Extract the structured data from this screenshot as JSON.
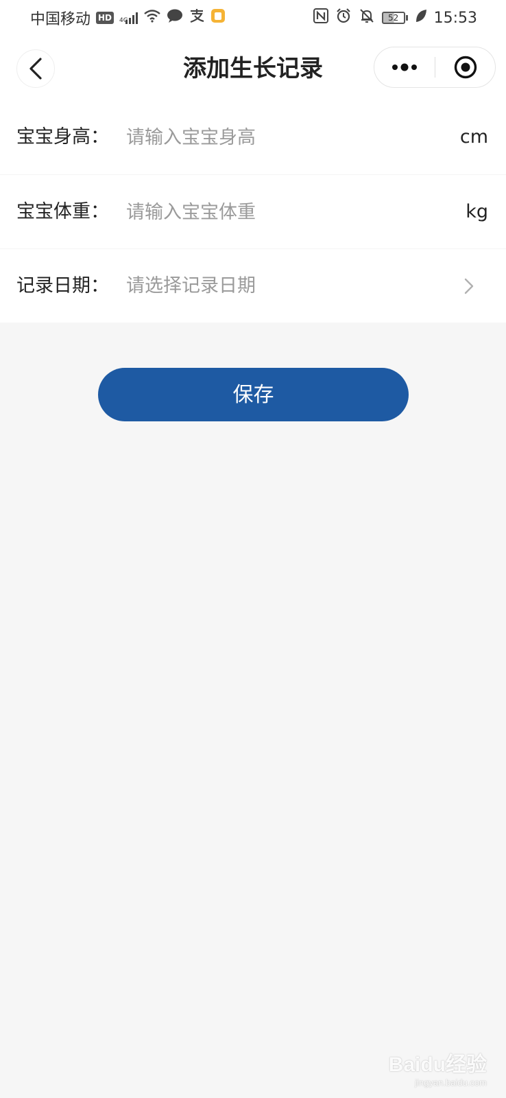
{
  "status_bar": {
    "carrier": "中国移动",
    "hd_badge": "HD",
    "network": "4G",
    "battery_level": "52",
    "time": "15:53",
    "icons_left": [
      "hd-icon",
      "signal-icon",
      "wifi-icon",
      "chat-bubble-icon",
      "alipay-icon",
      "app-notification-icon"
    ],
    "icons_right": [
      "nfc-icon",
      "alarm-icon",
      "mute-bell-icon",
      "battery-icon",
      "leaf-icon"
    ]
  },
  "nav": {
    "title": "添加生长记录",
    "back_icon": "chevron-left-icon",
    "more_icon": "more-dots-icon",
    "close_icon": "target-circle-icon"
  },
  "form": {
    "height": {
      "label": "宝宝身高：",
      "placeholder": "请输入宝宝身高",
      "unit": "cm"
    },
    "weight": {
      "label": "宝宝体重：",
      "placeholder": "请输入宝宝体重",
      "unit": "kg"
    },
    "date": {
      "label": "记录日期：",
      "placeholder": "请选择记录日期",
      "chevron_icon": "chevron-right-icon"
    }
  },
  "actions": {
    "save_label": "保存"
  },
  "watermark": {
    "main": "Baidu经验",
    "sub": "jingyan.baidu.com"
  },
  "colors": {
    "primary": "#1e5aa3",
    "background": "#f6f6f6",
    "placeholder": "#9a9a9a",
    "text": "#222222"
  }
}
